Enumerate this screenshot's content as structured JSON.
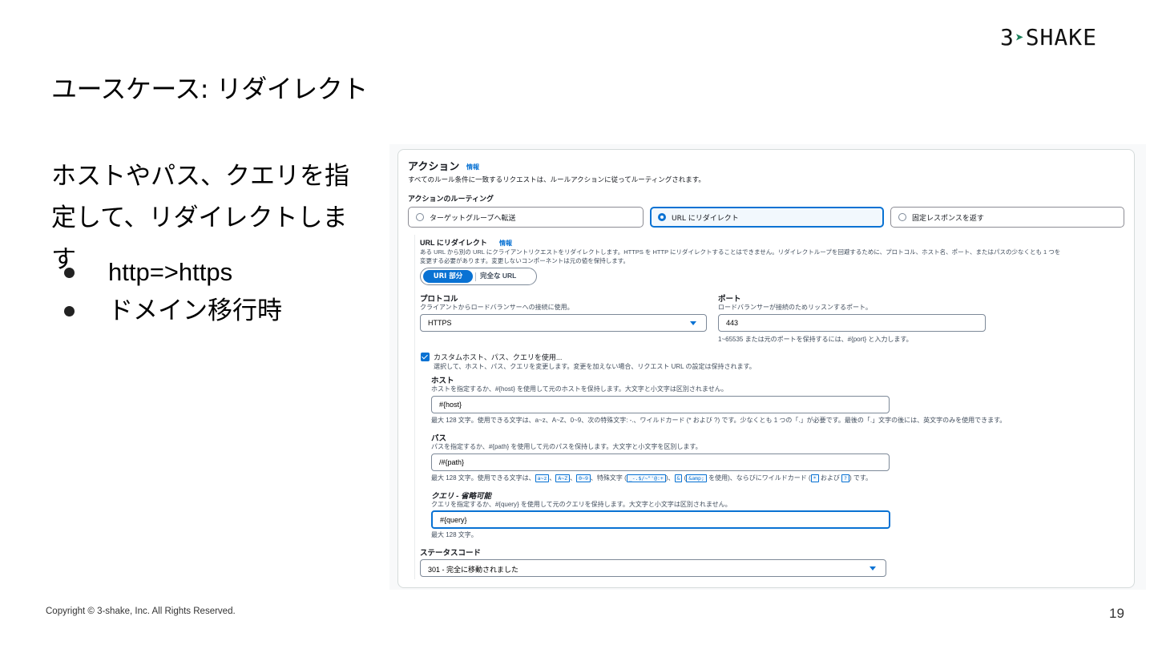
{
  "logo": {
    "num": "3",
    "text": "SHAKE"
  },
  "slide": {
    "title": "ユースケース: リダイレクト",
    "body_line1": "ホストやパス、クエリを指",
    "body_line2": "定して、リダイレクトします",
    "bullets": [
      "http=>https",
      "ドメイン移行時"
    ],
    "copyright": "Copyright © 3-shake, Inc. All Rights Reserved.",
    "page_number": "19"
  },
  "console": {
    "heading": "アクション",
    "info": "情報",
    "description": "すべてのルール条件に一致するリクエストは、ルールアクションに従ってルーティングされます。",
    "routing_label": "アクションのルーティング",
    "routing_options": [
      {
        "label": "ターゲットグループへ転送",
        "selected": false
      },
      {
        "label": "URL にリダイレクト",
        "selected": true
      },
      {
        "label": "固定レスポンスを返す",
        "selected": false
      }
    ],
    "redirect": {
      "heading": "URL にリダイレクト",
      "info": "情報",
      "desc1": "ある URL から別の URL にクライアントリクエストをリダイレクトします。HTTPS を HTTP にリダイレクトすることはできません。リダイレクトループを回避するために、プロトコル、ホスト名、ポート、またはパスの少なくとも 1 つを",
      "desc2": "変更する必要があります。変更しないコンポーネントは元の値を保持します。",
      "seg_on": "URI 部分",
      "seg_off": "完全な URL"
    },
    "protocol": {
      "label": "プロトコル",
      "desc": "クライアントからロードバランサーへの接続に使用。",
      "value": "HTTPS"
    },
    "port": {
      "label": "ポート",
      "desc": "ロードバランサーが接続のためリッスンするポート。",
      "value": "443",
      "hint": "1~65535 または元のポートを保持するには、#{port} と入力します。"
    },
    "custom": {
      "checkbox_label": "カスタムホスト、パス、クエリを使用...",
      "checkbox_desc": "選択して、ホスト、パス、クエリを変更します。変更を加えない場合、リクエスト URL の設定は保持されます。"
    },
    "host": {
      "label": "ホスト",
      "desc": "ホストを指定するか、#{host} を使用して元のホストを保持します。大文字と小文字は区別されません。",
      "value": "#{host}",
      "hint": "最大 128 文字。使用できる文字は、a~z、A~Z、0~9、次の特殊文字: -.、ワイルドカード (* および ?) です。少なくとも 1 つの「.」が必要です。最後の「.」文字の後には、英文字のみを使用できます。"
    },
    "path": {
      "label": "パス",
      "desc": "パスを指定するか、#{path} を使用して元のパスを保持します。大文字と小文字を区別します。",
      "value": "/#{path}",
      "hint_prefix": "最大 128 文字。使用できる文字は、",
      "code1": "a~z",
      "code2": "A~Z",
      "code3": "0~9",
      "hint_mid": "、特殊文字 (",
      "code4": "_-.$/~\"'@:+",
      "hint_mid2": ")、",
      "code5": "&",
      "hint_mid3": " (",
      "code6": "&amp;",
      "hint_mid4": " を使用)、ならびにワイルドカード (",
      "code7": "*",
      "hint_mid5": " および ",
      "code8": "?",
      "hint_end": ") です。"
    },
    "query": {
      "label": "クエリ - 省略可能",
      "desc": "クエリを指定するか、#{query} を使用して元のクエリを保持します。大文字と小文字は区別されません。",
      "value": "#{query}",
      "hint": "最大 128 文字。"
    },
    "status": {
      "label": "ステータスコード",
      "value": "301 - 完全に移動されました"
    }
  },
  "colors": {
    "accent": "#0972d3",
    "border": "#7d8998",
    "text": "#16191f"
  }
}
